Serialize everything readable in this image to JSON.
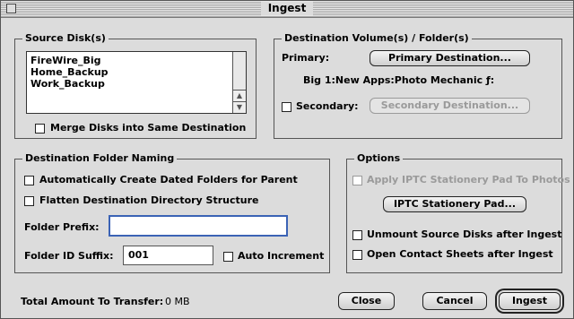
{
  "window": {
    "title": "Ingest"
  },
  "source": {
    "legend": "Source Disk(s)",
    "disks": [
      "FireWire_Big",
      "Home_Backup",
      "Work_Backup"
    ],
    "merge_label": "Merge Disks into Same Destination"
  },
  "destination": {
    "legend": "Destination Volume(s) / Folder(s)",
    "primary_label": "Primary:",
    "primary_button": "Primary Destination...",
    "primary_path": "Big 1:New Apps:Photo Mechanic ƒ:",
    "secondary_label": "Secondary:",
    "secondary_button": "Secondary Destination..."
  },
  "naming": {
    "legend": "Destination Folder Naming",
    "dated_label": "Automatically Create Dated Folders for Parent",
    "flatten_label": "Flatten Destination Directory Structure",
    "prefix_label": "Folder Prefix:",
    "prefix_value": "",
    "suffix_label": "Folder ID Suffix:",
    "suffix_value": "001",
    "auto_increment_label": "Auto Increment"
  },
  "options": {
    "legend": "Options",
    "iptc_stationery_label": "Apply IPTC Stationery Pad To Photos",
    "iptc_button": "IPTC Stationery Pad...",
    "unmount_label": "Unmount Source Disks after Ingest",
    "contact_sheets_label": "Open Contact Sheets after Ingest"
  },
  "footer": {
    "total_label": "Total Amount To Transfer:",
    "total_value": "0 MB",
    "close_button": "Close",
    "cancel_button": "Cancel",
    "ingest_button": "Ingest"
  },
  "colors": {
    "focus_ring": "#3b63b5",
    "window_bg": "#dcdcdc"
  }
}
